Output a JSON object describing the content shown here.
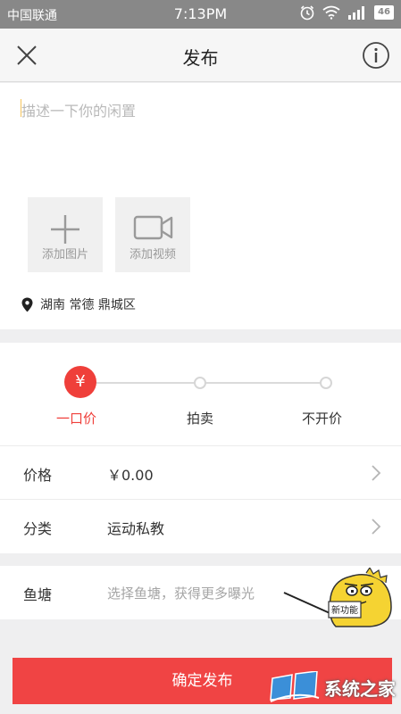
{
  "status_bar": {
    "carrier": "中国联通",
    "time": "7:13PM",
    "battery": "46"
  },
  "header": {
    "title": "发布"
  },
  "compose": {
    "placeholder": "描述一下你的闲置",
    "add_image_label": "添加图片",
    "add_video_label": "添加视频",
    "location": "湖南 常德 鼎城区"
  },
  "price_mode": {
    "active_symbol": "¥",
    "options": [
      {
        "label": "一口价",
        "active": true
      },
      {
        "label": "拍卖",
        "active": false
      },
      {
        "label": "不开价",
        "active": false
      }
    ]
  },
  "form": {
    "price_label": "价格",
    "price_value": "￥0.00",
    "category_label": "分类",
    "category_value": "运动私教",
    "pond_label": "鱼塘",
    "pond_placeholder": "选择鱼塘，获得更多曝光"
  },
  "mascot": {
    "sign_text": "新功能"
  },
  "submit": {
    "label": "确定发布"
  },
  "watermark": {
    "text": "系统之家"
  },
  "colors": {
    "accent": "#ef3f3a",
    "status_bar": "#888888",
    "submit_button": "#f04444"
  }
}
